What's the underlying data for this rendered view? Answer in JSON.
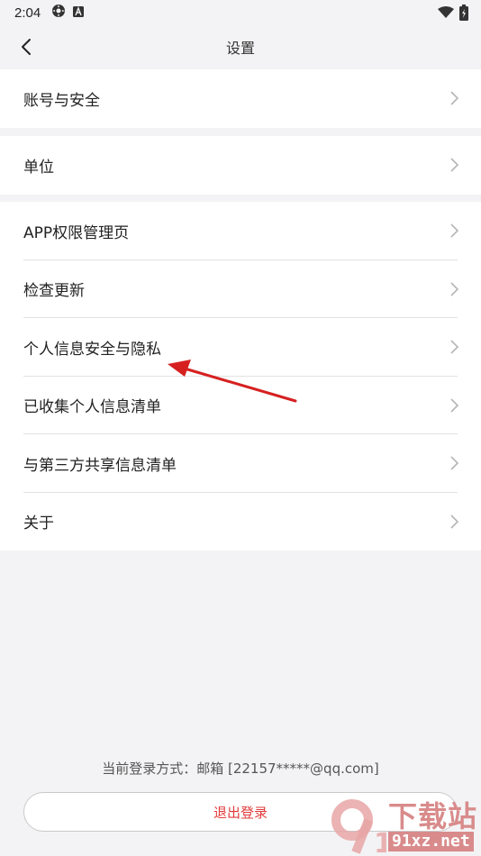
{
  "status_bar": {
    "time": "2:04",
    "icons": [
      "settings-gear-icon",
      "a-letter-icon",
      "wifi-icon",
      "battery-icon"
    ]
  },
  "nav": {
    "title": "设置",
    "back_icon": "chevron-left-icon"
  },
  "groups": [
    {
      "items": [
        {
          "label": "账号与安全"
        }
      ]
    },
    {
      "items": [
        {
          "label": "单位"
        }
      ]
    },
    {
      "items": [
        {
          "label": "APP权限管理页"
        },
        {
          "label": "检查更新"
        },
        {
          "label": "个人信息安全与隐私"
        },
        {
          "label": "已收集个人信息清单"
        },
        {
          "label": "与第三方共享信息清单"
        },
        {
          "label": "关于"
        }
      ]
    }
  ],
  "footer": {
    "login_method": "当前登录方式：邮箱 [22157*****@qq.com]",
    "logout_label": "退出登录"
  },
  "watermark": {
    "logo_text": "下载站",
    "site": "91xz.net"
  },
  "colors": {
    "background": "#f3f3f5",
    "logout_text": "#e23b3b",
    "annotation_arrow": "#d62020"
  }
}
